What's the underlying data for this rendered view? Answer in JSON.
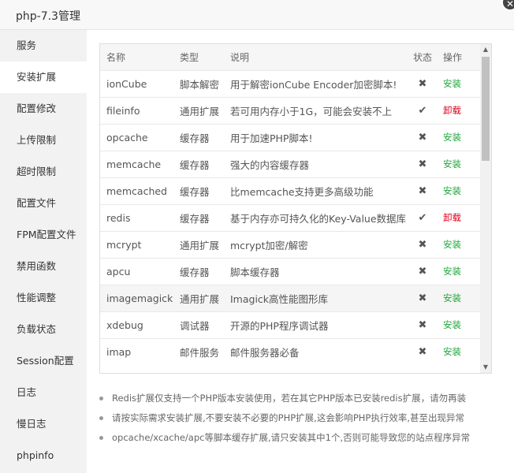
{
  "window": {
    "title": "php-7.3管理",
    "close_label": "✕"
  },
  "sidebar": {
    "items": [
      {
        "label": "服务"
      },
      {
        "label": "安装扩展"
      },
      {
        "label": "配置修改"
      },
      {
        "label": "上传限制"
      },
      {
        "label": "超时限制"
      },
      {
        "label": "配置文件"
      },
      {
        "label": "FPM配置文件"
      },
      {
        "label": "禁用函数"
      },
      {
        "label": "性能调整"
      },
      {
        "label": "负载状态"
      },
      {
        "label": "Session配置"
      },
      {
        "label": "日志"
      },
      {
        "label": "慢日志"
      },
      {
        "label": "phpinfo"
      }
    ],
    "active_index": 1
  },
  "table": {
    "headers": {
      "name": "名称",
      "type": "类型",
      "desc": "说明",
      "status": "状态",
      "op": "操作"
    },
    "rows": [
      {
        "name": "ionCube",
        "type": "脚本解密",
        "desc": "用于解密ionCube Encoder加密脚本!",
        "status": "✖",
        "op": "安装"
      },
      {
        "name": "fileinfo",
        "type": "通用扩展",
        "desc": "若可用内存小于1G，可能会安装不上",
        "status": "✔",
        "op": "卸载"
      },
      {
        "name": "opcache",
        "type": "缓存器",
        "desc": "用于加速PHP脚本!",
        "status": "✖",
        "op": "安装"
      },
      {
        "name": "memcache",
        "type": "缓存器",
        "desc": "强大的内容缓存器",
        "status": "✖",
        "op": "安装"
      },
      {
        "name": "memcached",
        "type": "缓存器",
        "desc": "比memcache支持更多高级功能",
        "status": "✖",
        "op": "安装"
      },
      {
        "name": "redis",
        "type": "缓存器",
        "desc": "基于内存亦可持久化的Key-Value数据库",
        "status": "✔",
        "op": "卸载"
      },
      {
        "name": "mcrypt",
        "type": "通用扩展",
        "desc": "mcrypt加密/解密",
        "status": "✖",
        "op": "安装"
      },
      {
        "name": "apcu",
        "type": "缓存器",
        "desc": "脚本缓存器",
        "status": "✖",
        "op": "安装"
      },
      {
        "name": "imagemagick",
        "type": "通用扩展",
        "desc": "Imagick高性能图形库",
        "status": "✖",
        "op": "安装"
      },
      {
        "name": "xdebug",
        "type": "调试器",
        "desc": "开源的PHP程序调试器",
        "status": "✖",
        "op": "安装"
      },
      {
        "name": "imap",
        "type": "邮件服务",
        "desc": "邮件服务器必备",
        "status": "✖",
        "op": "安装"
      }
    ],
    "hover_row_index": 8
  },
  "notes": [
    "Redis扩展仅支持一个PHP版本安装使用，若在其它PHP版本已安装redis扩展，请勿再装",
    "请按实际需求安装扩展,不要安装不必要的PHP扩展,这会影响PHP执行效率,甚至出现异常",
    "opcache/xcache/apc等脚本缓存扩展,请只安装其中1个,否则可能导致您的站点程序异常"
  ],
  "colors": {
    "install": "#20a53a",
    "uninstall": "#e0001a",
    "sidebar_bg": "#f2f2f2"
  }
}
